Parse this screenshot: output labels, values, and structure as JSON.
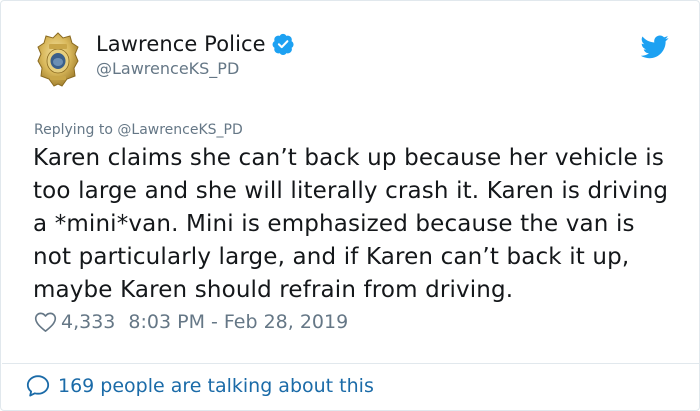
{
  "author": {
    "display_name": "Lawrence Police",
    "handle": "@LawrenceKS_PD",
    "verified": true,
    "avatar_icon": "police-badge"
  },
  "reply": {
    "prefix": "Replying to ",
    "handle": "@LawrenceKS_PD"
  },
  "tweet": {
    "text": "Karen claims she can’t back up because her vehicle is too large and she will literally crash it. Karen is driving a *mini*van. Mini is emphasized because the van is not particularly large, and if Karen can’t back it up, maybe Karen should refrain from driving.",
    "likes": "4,333",
    "timestamp": "8:03 PM - Feb 28, 2019"
  },
  "footer": {
    "talking_label": "169 people are talking about this"
  },
  "colors": {
    "twitter_blue": "#1da1f2",
    "muted_text": "#657786",
    "link_blue": "#1b6ba8",
    "text": "#14171a"
  }
}
